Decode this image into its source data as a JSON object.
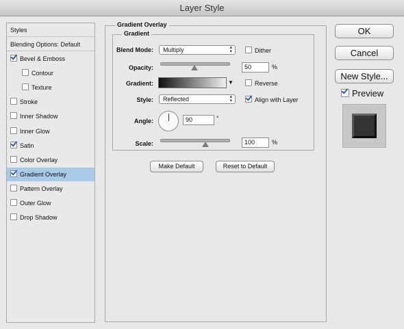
{
  "window": {
    "title": "Layer Style"
  },
  "sidebar": {
    "items": [
      {
        "label": "Styles",
        "checkbox": false
      },
      {
        "label": "Blending Options: Default",
        "checkbox": false
      },
      {
        "label": "Bevel & Emboss",
        "checkbox": true,
        "checked": true
      },
      {
        "label": "Contour",
        "checkbox": true,
        "checked": false
      },
      {
        "label": "Texture",
        "checkbox": true,
        "checked": false
      },
      {
        "label": "Stroke",
        "checkbox": true,
        "checked": false
      },
      {
        "label": "Inner Shadow",
        "checkbox": true,
        "checked": false
      },
      {
        "label": "Inner Glow",
        "checkbox": true,
        "checked": false
      },
      {
        "label": "Satin",
        "checkbox": true,
        "checked": true
      },
      {
        "label": "Color Overlay",
        "checkbox": true,
        "checked": false
      },
      {
        "label": "Gradient Overlay",
        "checkbox": true,
        "checked": true,
        "selected": true
      },
      {
        "label": "Pattern Overlay",
        "checkbox": true,
        "checked": false
      },
      {
        "label": "Outer Glow",
        "checkbox": true,
        "checked": false
      },
      {
        "label": "Drop Shadow",
        "checkbox": true,
        "checked": false
      }
    ]
  },
  "panel": {
    "group_title": "Gradient Overlay",
    "subgroup_title": "Gradient",
    "blend_mode_label": "Blend Mode:",
    "blend_mode_value": "Multiply",
    "dither_label": "Dither",
    "dither_checked": false,
    "opacity_label": "Opacity:",
    "opacity_value": "50",
    "opacity_unit": "%",
    "opacity_slider_fraction": 0.5,
    "gradient_label": "Gradient:",
    "reverse_label": "Reverse",
    "reverse_checked": false,
    "style_label": "Style:",
    "style_value": "Reflected",
    "align_label": "Align with Layer",
    "align_checked": true,
    "angle_label": "Angle:",
    "angle_value": "90",
    "angle_unit": "°",
    "scale_label": "Scale:",
    "scale_value": "100",
    "scale_unit": "%",
    "scale_slider_fraction": 0.66,
    "make_default_label": "Make Default",
    "reset_default_label": "Reset to Default"
  },
  "actions": {
    "ok_label": "OK",
    "cancel_label": "Cancel",
    "new_style_label": "New Style...",
    "preview_label": "Preview",
    "preview_checked": true
  },
  "icons": {
    "checkbox": "checkbox-icon",
    "popup_arrows": "updown-arrows-icon",
    "gradient_dropdown": "triangle-down-icon",
    "slider_thumb": "slider-thumb-icon",
    "angle_dial": "angle-dial-icon"
  }
}
